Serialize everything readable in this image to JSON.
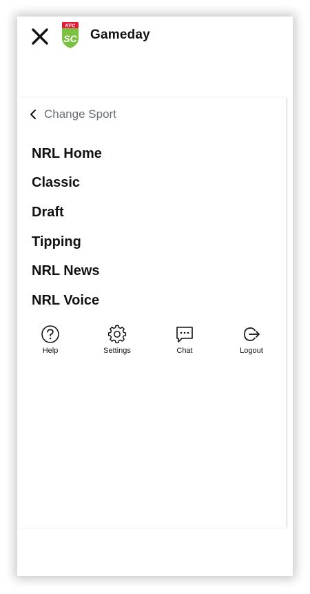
{
  "header": {
    "title": "Gameday",
    "close_icon": "close-icon",
    "logo_icon": "kfc-supercoach-logo",
    "logo_top_text": "KFC",
    "logo_mark_text": "SC"
  },
  "menu": {
    "change_sport_label": "Change Sport",
    "items": [
      {
        "label": "NRL Home"
      },
      {
        "label": "Classic"
      },
      {
        "label": "Draft"
      },
      {
        "label": "Tipping"
      },
      {
        "label": "NRL News"
      },
      {
        "label": "NRL Voice"
      }
    ]
  },
  "actions": [
    {
      "label": "Help",
      "icon": "help-icon"
    },
    {
      "label": "Settings",
      "icon": "gear-icon"
    },
    {
      "label": "Chat",
      "icon": "chat-icon"
    },
    {
      "label": "Logout",
      "icon": "logout-icon"
    }
  ],
  "colors": {
    "logo_green": "#7cc242",
    "logo_red": "#e31837",
    "secondary_text": "#6b6f75",
    "primary_text": "#111111"
  }
}
